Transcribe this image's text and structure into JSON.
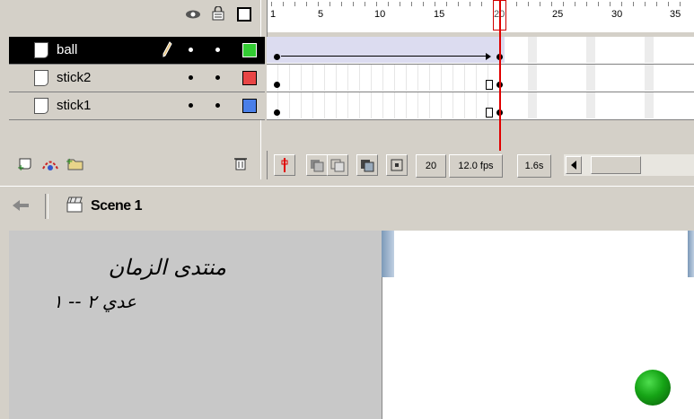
{
  "timeline": {
    "header_icons": [
      "eye-icon",
      "lock-icon",
      "outline-icon"
    ],
    "ruler_labels": [
      "1",
      "5",
      "10",
      "15",
      "20",
      "25",
      "30",
      "35"
    ],
    "layers": [
      {
        "name": "ball",
        "selected": true,
        "color": "#33cc33",
        "pencil": true
      },
      {
        "name": "stick2",
        "selected": false,
        "color": "#e84545",
        "pencil": false
      },
      {
        "name": "stick1",
        "selected": false,
        "color": "#4a7fe8",
        "pencil": false
      }
    ],
    "current_frame": "20",
    "frame_rate": "12.0 fps",
    "elapsed_time": "1.6s"
  },
  "scene": {
    "name": "Scene 1"
  },
  "stage": {
    "arabic_line1": "منتدى الزمان",
    "arabic_line2": "عدي ٢ -- ١",
    "ball_color": "#0f9a0f"
  }
}
